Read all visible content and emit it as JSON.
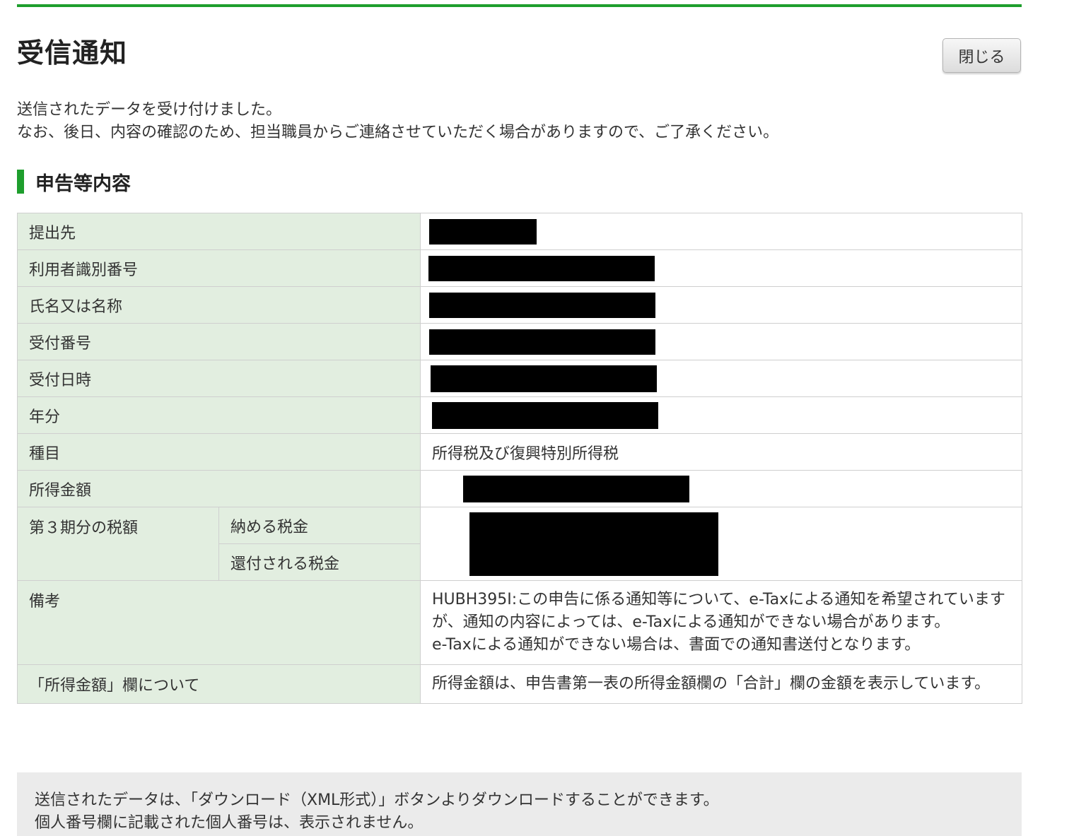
{
  "accent_color": "#1e9e2d",
  "header": {
    "title": "受信通知",
    "close_label": "閉じる"
  },
  "message": {
    "line1": "送信されたデータを受け付けました。",
    "line2": "なお、後日、内容の確認のため、担当職員からご連絡させていただく場合がありますので、ご了承ください。"
  },
  "section": {
    "title": "申告等内容"
  },
  "rows": {
    "submission_to": {
      "label": "提出先",
      "value_redacted": true
    },
    "user_id": {
      "label": "利用者識別番号",
      "value_redacted": true
    },
    "name": {
      "label": "氏名又は名称",
      "value_redacted": true
    },
    "receipt_number": {
      "label": "受付番号",
      "value_redacted": true
    },
    "receipt_datetime": {
      "label": "受付日時",
      "value_redacted": true
    },
    "year": {
      "label": "年分",
      "value_redacted": true
    },
    "tax_type": {
      "label": "種目",
      "value": "所得税及び復興特別所得税"
    },
    "income_amount": {
      "label": "所得金額",
      "value_redacted": true
    },
    "third_period_tax": {
      "label": "第３期分の税額",
      "payable_label": "納める税金",
      "refund_label": "還付される税金",
      "value_redacted": true
    },
    "remarks": {
      "label": "備考",
      "lines": [
        "HUBH395I:この申告に係る通知等について、e-Taxによる通知を希望されていますが、通知の内容によっては、e-Taxによる通知ができない場合があります。",
        "e-Taxによる通知ができない場合は、書面での通知書送付となります。"
      ]
    },
    "income_note": {
      "label": "「所得金額」欄について",
      "value": "所得金額は、申告書第一表の所得金額欄の「合計」欄の金額を表示しています。"
    }
  },
  "notice": {
    "line1": "送信されたデータは、「ダウンロード（XML形式）」ボタンよりダウンロードすることができます。",
    "line2": "個人番号欄に記載された個人番号は、表示されません。"
  }
}
